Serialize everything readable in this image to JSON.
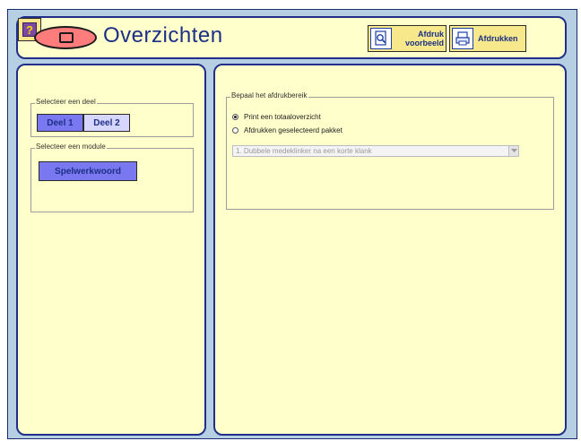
{
  "header": {
    "title": "Overzichten",
    "buttons": {
      "preview_label": "Afdruk\nvoorbeeld",
      "print_label": "Afdrukken",
      "help_label": "?"
    }
  },
  "left": {
    "deel_group_title": "Selecteer een deel",
    "deel_buttons": [
      {
        "label": "Deel 1",
        "selected": true
      },
      {
        "label": "Deel 2",
        "selected": false
      }
    ],
    "module_group_title": "Selecteer een module",
    "module_button": "Spelwerkwoord"
  },
  "right": {
    "range_group_title": "Bepaal het afdrukbereik",
    "options": [
      {
        "label": "Print een totaaloverzicht",
        "checked": true
      },
      {
        "label": "Afdrukken geselecteerd pakket",
        "checked": false
      }
    ],
    "package_select": {
      "value": "1. Dubbele medeklinker na een korte klank",
      "disabled": true
    }
  },
  "colors": {
    "background": "#b7cfe3",
    "panel": "#ffffcc",
    "accent": "#1c2f86",
    "selected": "#7a78f0",
    "logo": "#ff7c7c"
  },
  "icons": [
    "logo-icon",
    "magnifier-page-icon",
    "printer-icon",
    "help-icon",
    "dropdown-arrow-icon"
  ]
}
